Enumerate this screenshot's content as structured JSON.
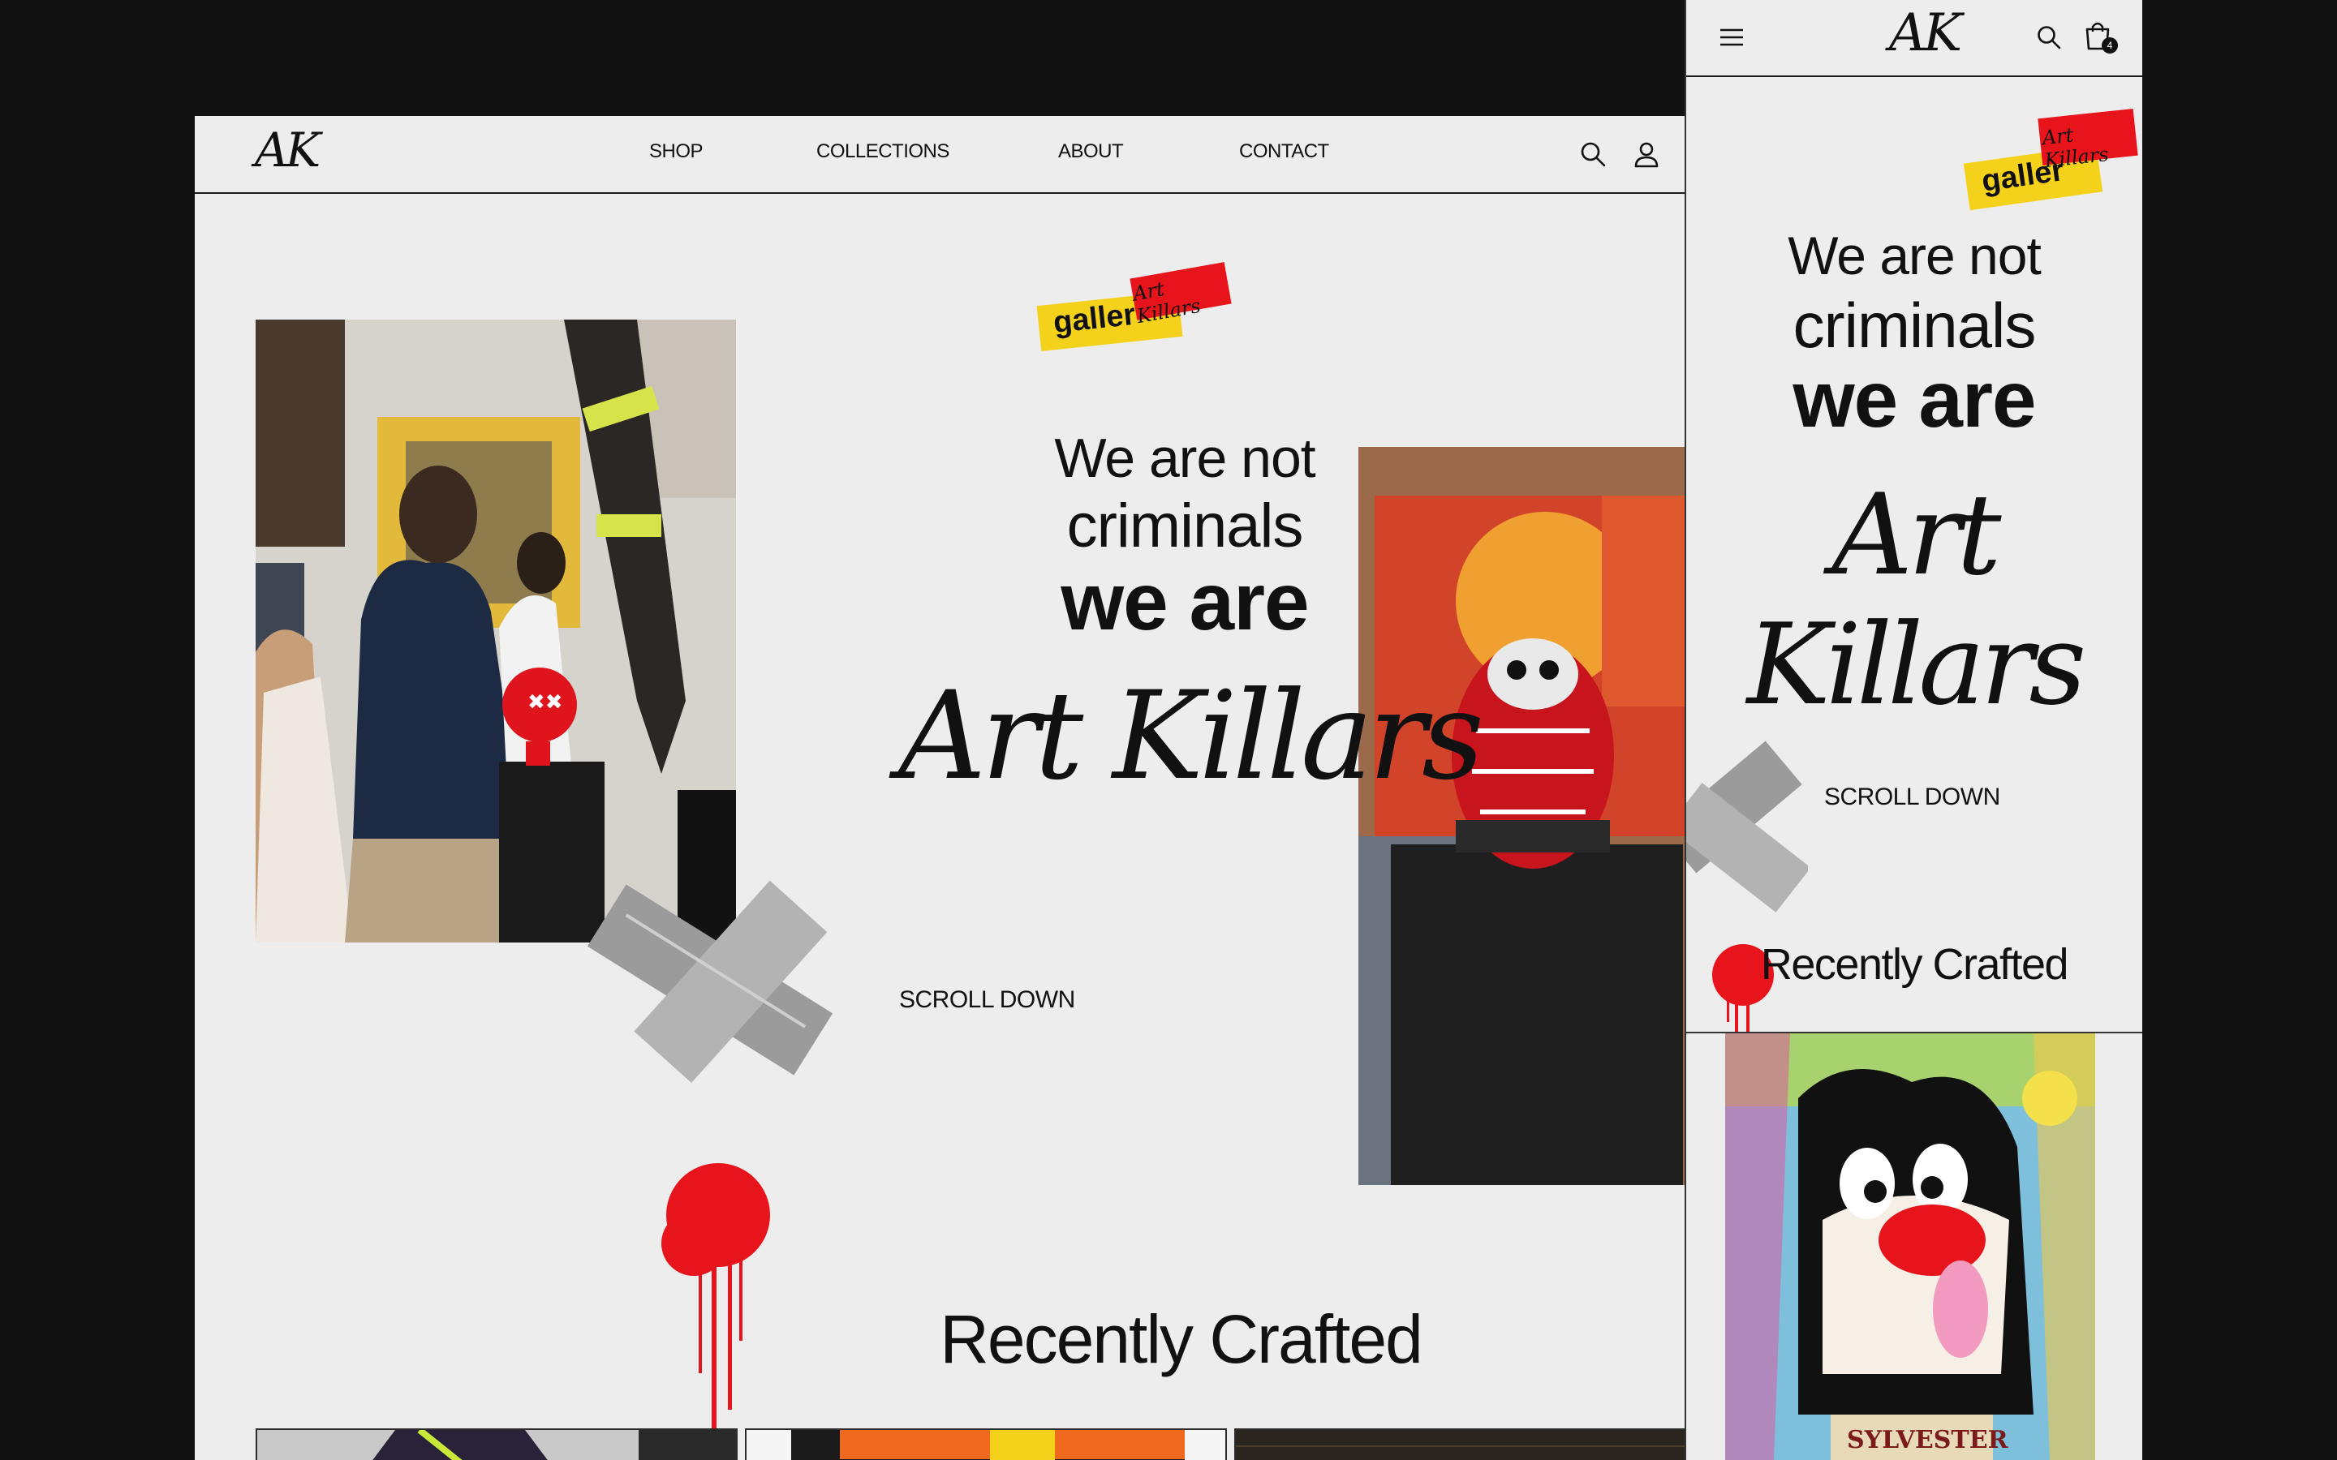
{
  "brand": {
    "logo_text": "AK"
  },
  "desktop": {
    "nav": [
      {
        "label": "SHOP"
      },
      {
        "label": "COLLECTIONS"
      },
      {
        "label": "ABOUT"
      },
      {
        "label": "CONTACT"
      }
    ],
    "sticker": {
      "yellow_text": "galler",
      "red_text": "Art Killars"
    },
    "hero": {
      "line1": "We are not",
      "line2": "criminals",
      "line3": "we are",
      "signature": "Art Killars",
      "scroll_label": "SCROLL DOWN"
    },
    "section_title": "Recently Crafted"
  },
  "mobile": {
    "cart_count": "4",
    "sticker": {
      "yellow_text": "galler",
      "red_text": "Art Killars"
    },
    "hero": {
      "line1": "We are not",
      "line2": "criminals",
      "line3": "we are",
      "signature": "Art Killars",
      "scroll_label": "SCROLL DOWN"
    },
    "section_title": "Recently Crafted",
    "artwork_caption": "SYLVESTER"
  },
  "icons": {
    "search": "search-icon",
    "account": "user-icon",
    "menu": "hamburger-menu-icon",
    "cart": "shopping-bag-icon"
  },
  "colors": {
    "page_background": "#ededed",
    "frame_background": "#121213",
    "text": "#111111",
    "spray_red": "#e8141b",
    "sticker_yellow": "#f4d21c",
    "tape_gray": "#9a9a9a"
  }
}
